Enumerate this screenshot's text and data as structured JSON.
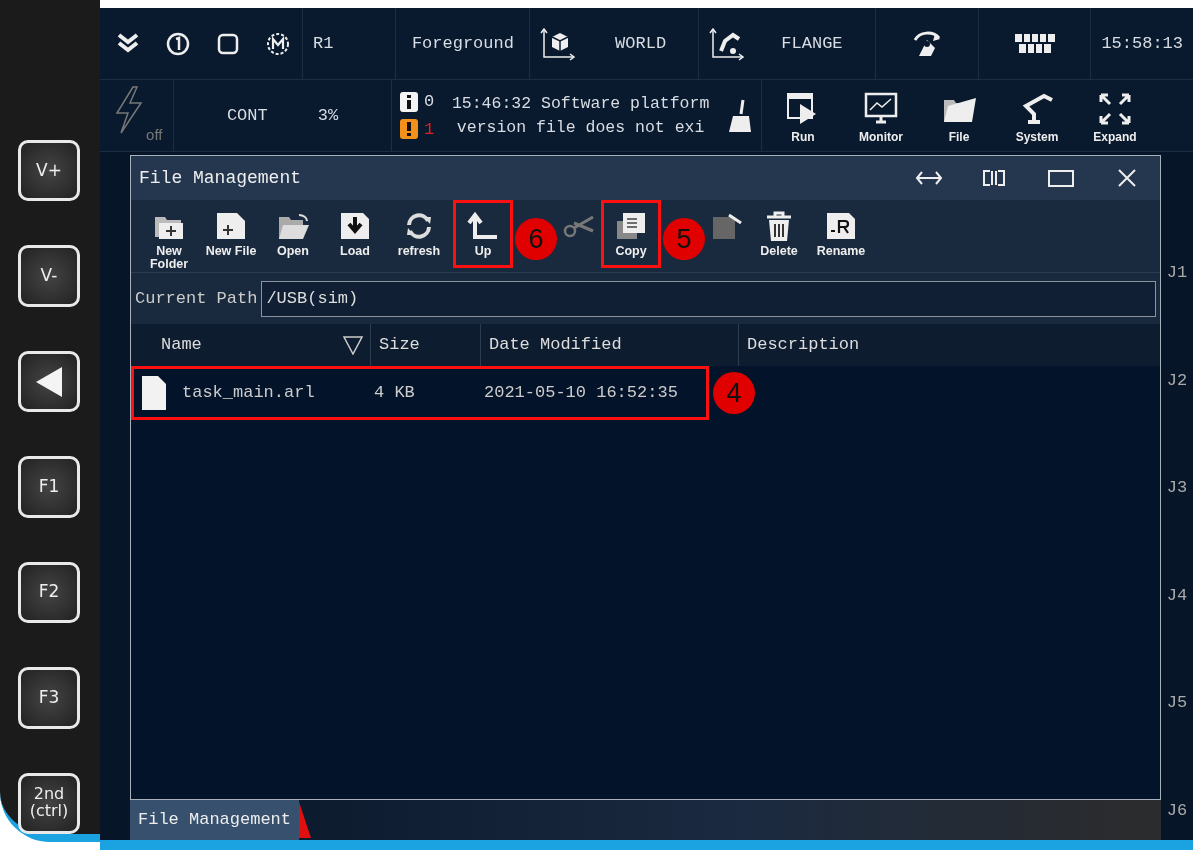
{
  "keypad": [
    {
      "kind": "text",
      "label": "V+"
    },
    {
      "kind": "text",
      "label": "V-"
    },
    {
      "kind": "back"
    },
    {
      "kind": "text",
      "label": "F1"
    },
    {
      "kind": "text",
      "label": "F2"
    },
    {
      "kind": "text",
      "label": "F3"
    },
    {
      "kind": "text",
      "label": "2nd (ctrl)"
    }
  ],
  "status_bar": {
    "robot": "R1",
    "mode": "Foreground",
    "coord_frame": "WORLD",
    "tool_frame": "FLANGE",
    "time": "15:58:13"
  },
  "control_bar": {
    "power_label": "off",
    "run_mode": "CONT",
    "speed": "3%",
    "info_count": "0",
    "warning_count": "1",
    "message_lines": [
      "15:46:32 Software platform",
      "version file does not exi"
    ],
    "nav_buttons": [
      {
        "kind": "run",
        "label": "Run"
      },
      {
        "kind": "monitor",
        "label": "Monitor"
      },
      {
        "kind": "file",
        "label": "File"
      },
      {
        "kind": "system",
        "label": "System"
      },
      {
        "kind": "expand",
        "label": "Expand"
      }
    ]
  },
  "window": {
    "title": "File Management",
    "toolbar": [
      {
        "kind": "new-folder",
        "label": "New Folder",
        "highlighted": false
      },
      {
        "kind": "new-file",
        "label": "New File",
        "highlighted": false
      },
      {
        "kind": "open",
        "label": "Open",
        "highlighted": false
      },
      {
        "kind": "load",
        "label": "Load",
        "highlighted": false
      },
      {
        "kind": "refresh",
        "label": "refresh",
        "highlighted": false
      },
      {
        "kind": "up",
        "label": "Up",
        "highlighted": true
      },
      {
        "kind": "callout",
        "label": "6"
      },
      {
        "kind": "cut",
        "highlighted": false
      },
      {
        "kind": "copy",
        "label": "Copy",
        "highlighted": true
      },
      {
        "kind": "callout",
        "label": "5"
      },
      {
        "kind": "paste",
        "highlighted": false
      },
      {
        "kind": "delete",
        "label": "Delete",
        "highlighted": false
      },
      {
        "kind": "rename",
        "label": "Rename",
        "highlighted": false
      }
    ],
    "path_label": "Current Path",
    "path": "/USB(sim)",
    "columns": [
      "Name",
      "Size",
      "Date Modified",
      "Description"
    ],
    "rows": [
      {
        "name": "task_main.arl",
        "size": "4 KB",
        "date_modified": "2021-05-10 16:52:35",
        "highlighted": true,
        "callout": "4"
      }
    ],
    "taskbar_tab": "File Management"
  },
  "axis_labels": [
    "J1",
    "J2",
    "J3",
    "J4",
    "J5",
    "J6"
  ]
}
